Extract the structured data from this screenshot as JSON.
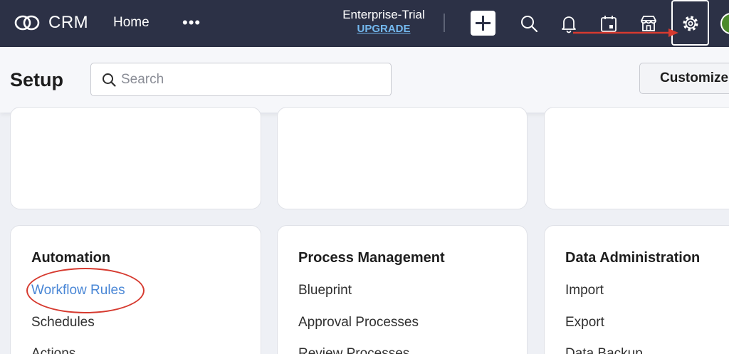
{
  "app": {
    "logo_text": "CRM",
    "nav_home": "Home",
    "nav_more": "•••",
    "edition": "Enterprise-Trial",
    "upgrade": "UPGRADE"
  },
  "icons": {
    "logo": "zoho-rings-icon",
    "plus": "plus-icon",
    "search": "search-icon",
    "bell": "bell-icon",
    "calendar": "calendar-icon",
    "store": "marketplace-store-icon",
    "gear": "gear-icon"
  },
  "colors": {
    "topbar": "#2c3146",
    "link_active": "#4a87d6",
    "upgrade": "#74b9f0",
    "annotation": "#d63a2f",
    "avatar": "#4c8a2c"
  },
  "setup": {
    "title": "Setup",
    "search_placeholder": "Search",
    "customize_label": "Customize"
  },
  "cards": [
    {
      "title": "Automation",
      "links": [
        "Workflow Rules",
        "Schedules",
        "Actions"
      ]
    },
    {
      "title": "Process Management",
      "links": [
        "Blueprint",
        "Approval Processes",
        "Review Processes"
      ]
    },
    {
      "title": "Data Administration",
      "links": [
        "Import",
        "Export",
        "Data Backup"
      ]
    }
  ]
}
